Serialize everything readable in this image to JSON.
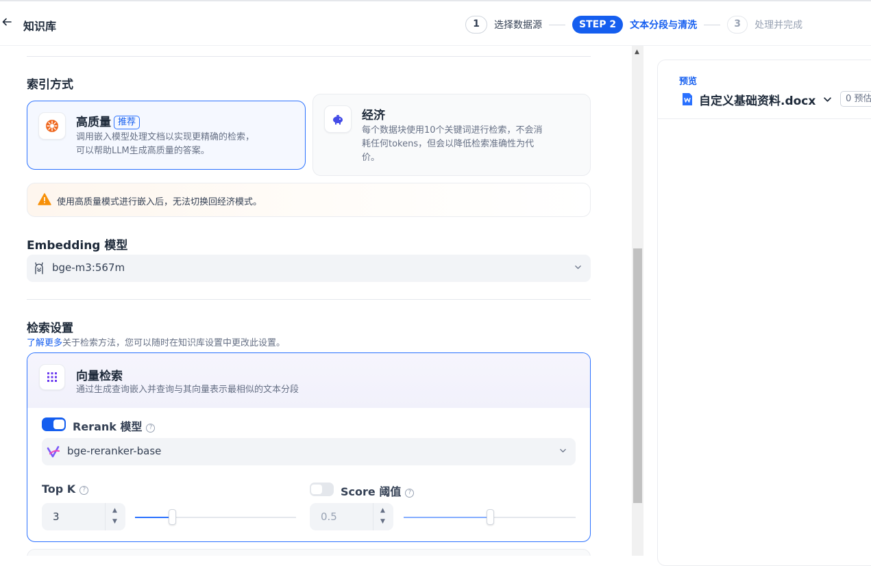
{
  "header": {
    "title": "知识库",
    "steps": [
      {
        "num": "1",
        "label": "选择数据源"
      },
      {
        "num": "STEP 2",
        "label": "文本分段与清洗"
      },
      {
        "num": "3",
        "label": "处理并完成"
      }
    ]
  },
  "index": {
    "heading": "索引方式",
    "high_quality": {
      "title": "高质量",
      "badge": "推荐",
      "desc_line1": "调用嵌入模型处理文档以实现更精确的检索，",
      "desc_line2": "可以帮助LLM生成高质量的答案。"
    },
    "economy": {
      "title": "经济",
      "desc_line1": "每个数据块使用10个关键词进行检索，不会消",
      "desc_line2": "耗任何tokens，但会以降低检索准确性为代",
      "desc_line3": "价。"
    },
    "warning": "使用高质量模式进行嵌入后，无法切换回经济模式。"
  },
  "embedding": {
    "heading": "Embedding 模型",
    "model": "bge-m3:567m"
  },
  "retrieval": {
    "heading": "检索设置",
    "learn_more": "了解更多",
    "hint": "关于检索方法，您可以随时在知识库设置中更改此设置。",
    "vector": {
      "title": "向量检索",
      "desc": "通过生成查询嵌入并查询与其向量表示最相似的文本分段"
    },
    "rerank": {
      "label": "Rerank 模型",
      "enabled": true,
      "model": "bge-reranker-base"
    },
    "top_k": {
      "label": "Top K",
      "value": "3",
      "slider_fraction": 0.23
    },
    "score": {
      "label": "Score 阈值",
      "enabled": false,
      "value": "0.5",
      "slider_fraction": 0.5
    }
  },
  "preview": {
    "label": "预览",
    "file": "自定义基础资料.docx",
    "count": "0 预估"
  },
  "colors": {
    "primary": "#155eef",
    "accent": "#2970ff",
    "warning": "#f79009"
  },
  "icons": [
    "back-arrow-icon",
    "rocket-icon",
    "piggy-bank-icon",
    "warning-triangle-icon",
    "ollama-icon",
    "grid-dots-icon",
    "question-icon",
    "rerank-logo-icon",
    "word-doc-icon",
    "chevron-down-icon"
  ]
}
